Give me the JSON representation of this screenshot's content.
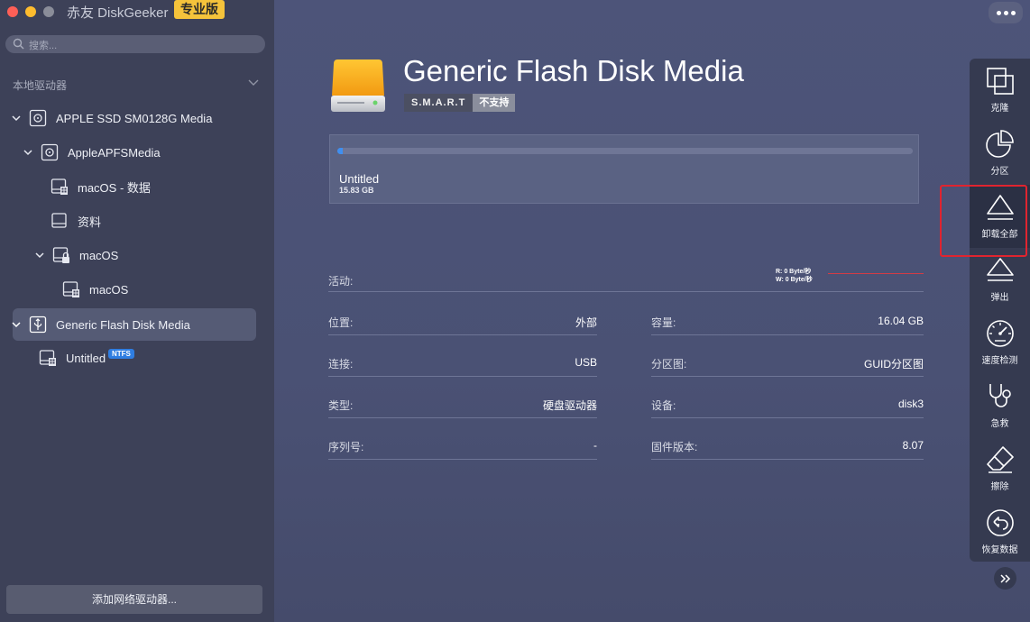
{
  "app": {
    "title": "赤友 DiskGeeker",
    "edition_badge": "专业版"
  },
  "search": {
    "placeholder": "搜索..."
  },
  "sidebar": {
    "section_label": "本地驱动器",
    "items": [
      {
        "label": "APPLE SSD SM0128G Media",
        "icon": "internal-disk-icon"
      },
      {
        "label": "AppleAPFSMedia",
        "icon": "apfs-container-icon"
      },
      {
        "label": "macOS - 数据",
        "icon": "volume-icon"
      },
      {
        "label": "资料",
        "icon": "volume-icon"
      },
      {
        "label": "macOS",
        "icon": "locked-volume-icon"
      },
      {
        "label": "macOS",
        "icon": "volume-icon"
      },
      {
        "label": "Generic Flash Disk Media",
        "icon": "usb-icon"
      },
      {
        "label": "Untitled",
        "icon": "volume-icon",
        "badge": "NTFS"
      }
    ],
    "add_network_label": "添加网络驱动器..."
  },
  "disk": {
    "name": "Generic Flash Disk Media",
    "smart_key": "S.M.A.R.T",
    "smart_value": "不支持"
  },
  "volume": {
    "name": "Untitled",
    "size": "15.83 GB",
    "used_fraction": 0.01,
    "bar_color": "#3f8ff0"
  },
  "activity": {
    "label": "活动:",
    "read": "R: 0 Byte/秒",
    "write": "W: 0 Byte/秒",
    "line_color": "#d33b45"
  },
  "info": {
    "location_label": "位置:",
    "location_value": "外部",
    "capacity_label": "容量:",
    "capacity_value": "16.04 GB",
    "connection_label": "连接:",
    "connection_value": "USB",
    "partition_map_label": "分区图:",
    "partition_map_value": "GUID分区图",
    "type_label": "类型:",
    "type_value": "硬盘驱动器",
    "device_label": "设备:",
    "device_value": "disk3",
    "serial_label": "序列号:",
    "serial_value": "-",
    "firmware_label": "固件版本:",
    "firmware_value": "8.07"
  },
  "toolbar": {
    "clone": "克隆",
    "partition": "分区",
    "unmount_all": "卸载全部",
    "eject": "弹出",
    "speed_test": "速度检测",
    "first_aid": "急救",
    "erase": "擦除",
    "recover": "恢复数据"
  },
  "colors": {
    "accent": "#f5c33b",
    "highlight": "#e0242f",
    "ntfs_badge": "#2f7de1"
  }
}
